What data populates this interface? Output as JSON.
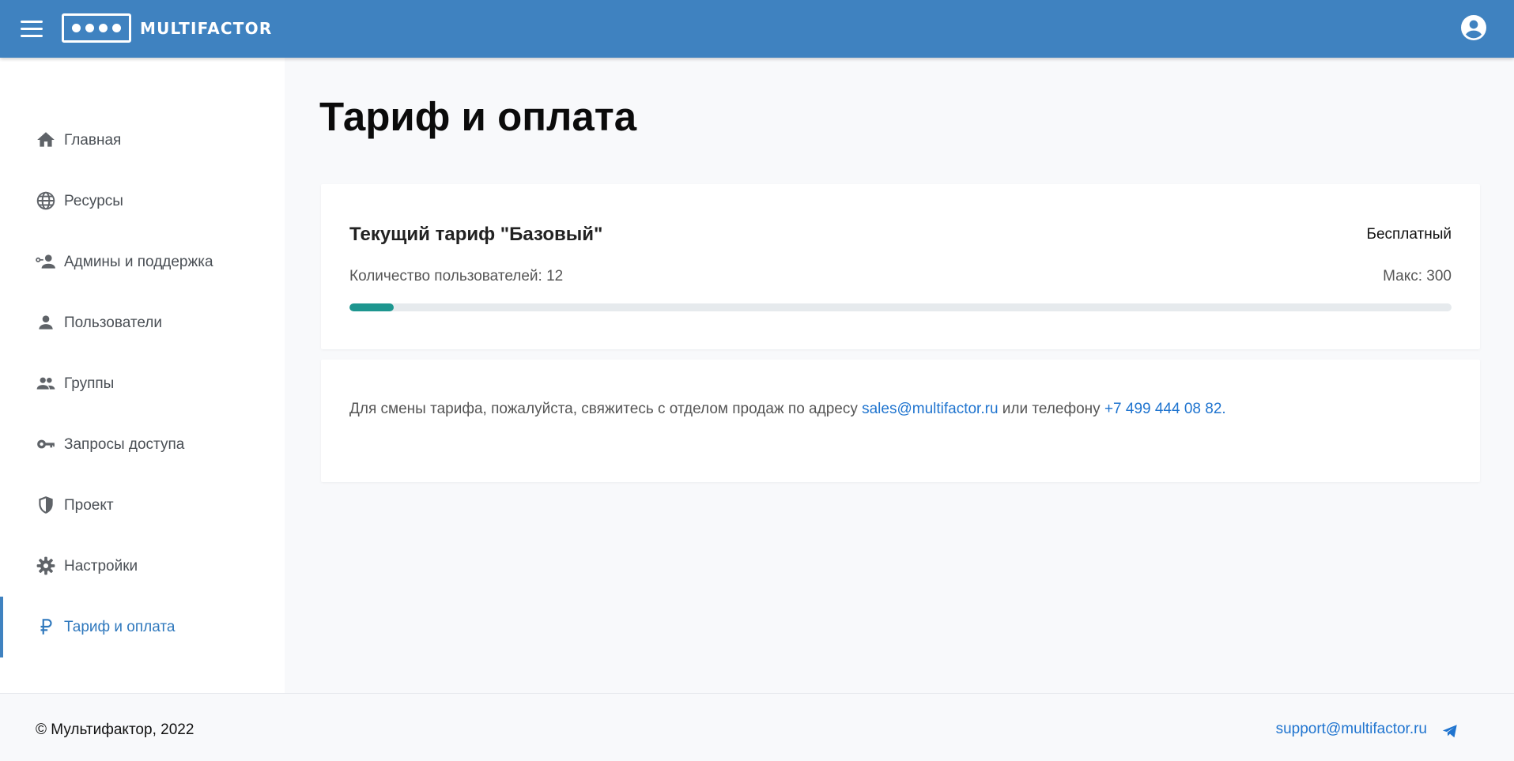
{
  "header": {
    "logo_text": "MULTIFACTOR",
    "bg_color": "#3f82c0",
    "icons": {
      "menu": "menu-icon",
      "account": "account-circle-icon"
    }
  },
  "sidebar": {
    "items": [
      {
        "label": "Главная",
        "icon": "home-icon",
        "active": false
      },
      {
        "label": "Ресурсы",
        "icon": "globe-icon",
        "active": false
      },
      {
        "label": "Админы и поддержка",
        "icon": "admin-support-icon",
        "active": false
      },
      {
        "label": "Пользователи",
        "icon": "person-icon",
        "active": false
      },
      {
        "label": "Группы",
        "icon": "group-icon",
        "active": false
      },
      {
        "label": "Запросы доступа",
        "icon": "key-icon",
        "active": false
      },
      {
        "label": "Проект",
        "icon": "shield-icon",
        "active": false
      },
      {
        "label": "Настройки",
        "icon": "gear-icon",
        "active": false
      },
      {
        "label": "Тариф и оплата",
        "icon": "ruble-icon",
        "active": true
      }
    ],
    "active_color": "#2f78bd"
  },
  "main": {
    "title": "Тариф и оплата",
    "plan": {
      "name": "Текущий тариф \"Базовый\"",
      "price": "Бесплатный",
      "users_label": "Количество пользователей: 12",
      "max_label": "Макс: 300",
      "users_used": 12,
      "users_max": 300,
      "progress_color": "#1d968f"
    },
    "contact": {
      "text_before": "Для смены тарифа, пожалуйста, свяжитесь с отделом продаж по адресу ",
      "email": "sales@multifactor.ru",
      "text_middle": " или телефону ",
      "phone": "+7 499 444 08 82",
      "text_after": ".",
      "link_color": "#1f74cf"
    }
  },
  "footer": {
    "copyright": "© Мультифактор, 2022",
    "support_email": "support@multifactor.ru",
    "telegram_icon": "telegram-icon"
  }
}
